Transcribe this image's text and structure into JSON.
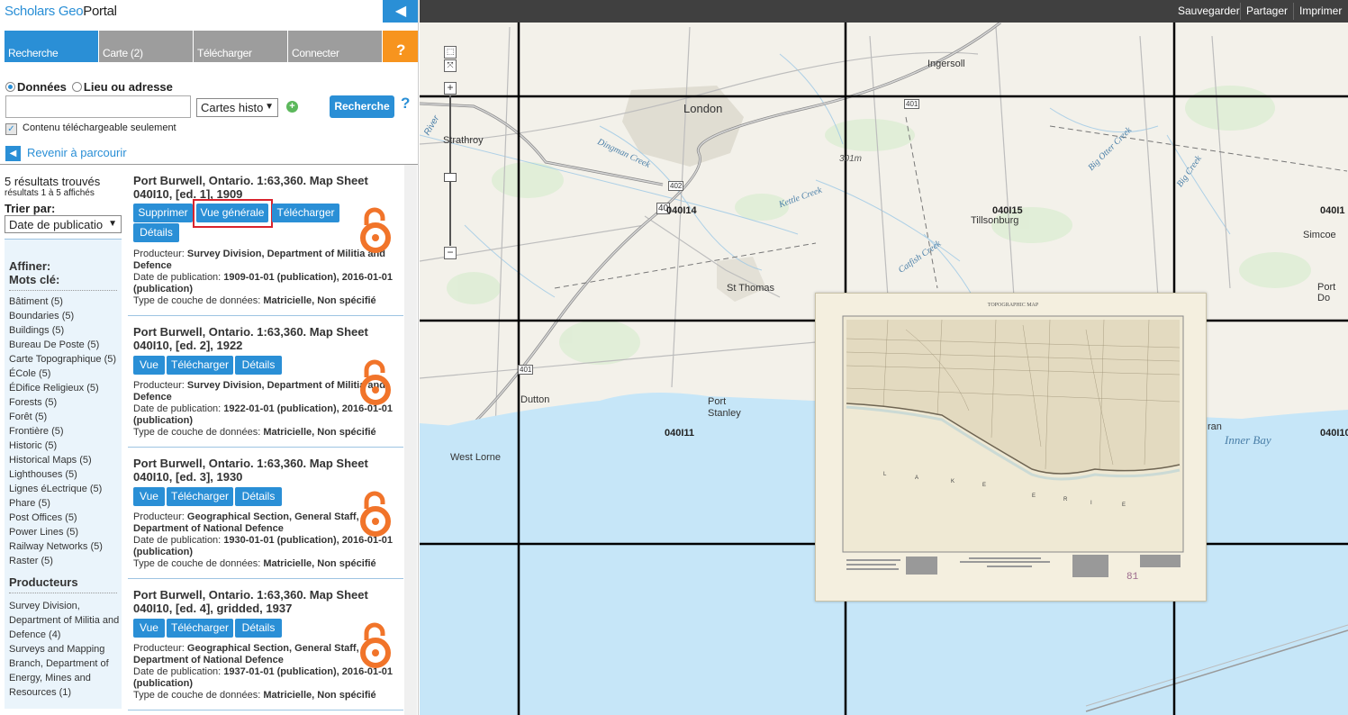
{
  "app": {
    "logo_a": "Scholars",
    "logo_b": " Geo",
    "logo_c": "Portal",
    "collapse_icon": "◀"
  },
  "tabs": [
    {
      "label": "Recherche",
      "active": true
    },
    {
      "label": "Carte (2)"
    },
    {
      "label": "Télécharger"
    },
    {
      "label": "Connecter"
    },
    {
      "label": "?"
    }
  ],
  "search": {
    "mode_data": "Données",
    "mode_place": "Lieu ou adresse",
    "input_value": "",
    "collection_select": "Cartes histo",
    "search_button": "Recherche",
    "help": "?",
    "downloadable_only": "Contenu téléchargeable seulement",
    "back": "Revenir à parcourir"
  },
  "results_info": {
    "count": "5 résultats trouvés",
    "showing": "résultats 1 à 5 affichés",
    "sort_label": "Trier par:",
    "sort_value": "Date de publicatio"
  },
  "facets": {
    "refine": "Affiner:",
    "keywords_label": "Mots clé:",
    "keywords": [
      "Bâtiment (5)",
      "Boundaries (5)",
      "Buildings (5)",
      "Bureau De Poste (5)",
      "Carte Topographique (5)",
      "ÉCole (5)",
      "ÉDifice Religieux (5)",
      "Forests (5)",
      "Forêt (5)",
      "Frontière (5)",
      "Historic (5)",
      "Historical Maps (5)",
      "Lighthouses (5)",
      "Lignes éLectrique (5)",
      "Phare (5)",
      "Post Offices (5)",
      "Power Lines (5)",
      "Railway Networks (5)",
      "Raster (5)"
    ],
    "producers_label": "Producteurs",
    "producers": [
      "Survey Division, Department of Militia and Defence (4)",
      "Surveys and Mapping Branch, Department of Energy, Mines and Resources (1)"
    ]
  },
  "results": [
    {
      "title": "Port Burwell, Ontario. 1:63,360. Map Sheet 040I10, [ed. 1], 1909",
      "buttons": [
        "Supprimer",
        "Vue générale",
        "Télécharger",
        "Détails"
      ],
      "producer_label": "Producteur: ",
      "producer": "Survey Division, Department of Militia and Defence",
      "date_label": "Date de publication: ",
      "date": "1909-01-01 (publication), 2016-01-01 (publication)",
      "type_label": "Type de couche de données: ",
      "type": "Matricielle, Non spécifié"
    },
    {
      "title": "Port Burwell, Ontario. 1:63,360. Map Sheet 040I10, [ed. 2], 1922",
      "buttons": [
        "Vue",
        "Télécharger",
        "Détails"
      ],
      "producer_label": "Producteur: ",
      "producer": "Survey Division, Department of Militia and Defence",
      "date_label": "Date de publication: ",
      "date": "1922-01-01 (publication), 2016-01-01 (publication)",
      "type_label": "Type de couche de données: ",
      "type": "Matricielle, Non spécifié"
    },
    {
      "title": "Port Burwell, Ontario. 1:63,360. Map Sheet 040I10, [ed. 3], 1930",
      "buttons": [
        "Vue",
        "Télécharger",
        "Détails"
      ],
      "producer_label": "Producteur: ",
      "producer": "Geographical Section, General Staff, Department of National Defence",
      "date_label": "Date de publication: ",
      "date": "1930-01-01 (publication), 2016-01-01 (publication)",
      "type_label": "Type de couche de données: ",
      "type": "Matricielle, Non spécifié"
    },
    {
      "title": "Port Burwell, Ontario. 1:63,360. Map Sheet 040I10, [ed. 4], gridded, 1937",
      "buttons": [
        "Vue",
        "Télécharger",
        "Détails"
      ],
      "producer_label": "Producteur: ",
      "producer": "Geographical Section, General Staff, Department of National Defence",
      "date_label": "Date de publication: ",
      "date": "1937-01-01 (publication), 2016-01-01 (publication)",
      "type_label": "Type de couche de données: ",
      "type": "Matricielle, Non spécifié"
    }
  ],
  "map": {
    "toolbar": [
      "Sauvegarder",
      "Partager",
      "Imprimer"
    ],
    "zoom_in": "+",
    "zoom_out": "−",
    "places": [
      "London",
      "Ingersoll",
      "Strathroy",
      "Tillsonburg",
      "St Thomas",
      "Simcoe",
      "Port Do",
      "Dutton",
      "Port",
      "Stanley",
      "West Lorne",
      "Inner Bay",
      "ran",
      "401",
      "402",
      "40",
      "401",
      "301m",
      "River",
      "Dingman Creek",
      "Big Otter Creek",
      "Kettle Creek",
      "Catfish Creek",
      "Big Creek"
    ],
    "grid": [
      "040I14",
      "040I15",
      "040I1",
      "040I11",
      "040I10"
    ],
    "thumbnail": {
      "title": "TOPOGRAPHIC MAP",
      "lake_letters": [
        "L",
        "A",
        "K",
        "E",
        "E",
        "R",
        "I",
        "E"
      ],
      "sheet_no": "81"
    }
  },
  "colors": {
    "accent": "#2a8fd6",
    "help": "#f7941e",
    "highlight": "#d9232d",
    "open_access": "#f1742a",
    "water": "#c6e6f8"
  }
}
